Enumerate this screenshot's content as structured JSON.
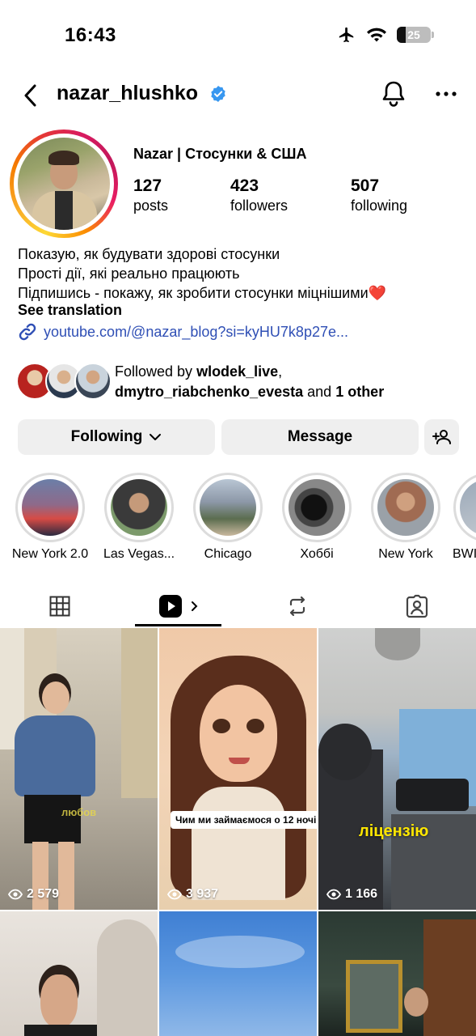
{
  "status_bar": {
    "time": "16:43",
    "battery": "25"
  },
  "header": {
    "username": "nazar_hlushko"
  },
  "profile": {
    "display_name": "Nazar | Стосунки & США",
    "stats": [
      {
        "value": "127",
        "label": "posts"
      },
      {
        "value": "423",
        "label": "followers"
      },
      {
        "value": "507",
        "label": "following"
      }
    ],
    "bio": [
      "Показую, як будувати здорові стосунки",
      "Прості дії, які реально працюють",
      "Підпишись - покажу, як зробити стосунки міцнішими"
    ],
    "bio_emoji": "❤️",
    "see_translation": "See translation",
    "link": "youtube.com/@nazar_blog?si=kyHU7k8p27e...",
    "followed_by": {
      "prefix": "Followed by",
      "user1": "wlodek_live",
      "user2": "dmytro_riabchenko_evesta",
      "and": "and",
      "others": "1 other"
    }
  },
  "actions": {
    "following": "Following",
    "message": "Message"
  },
  "highlights": [
    {
      "label": "New York 2.0"
    },
    {
      "label": "Las  Vegas..."
    },
    {
      "label": "Chicago"
    },
    {
      "label": "Хоббі"
    },
    {
      "label": "New York"
    },
    {
      "label": "BWI"
    }
  ],
  "grid": [
    {
      "views": "2 579",
      "caption": "любов"
    },
    {
      "views": "3 937",
      "caption": "Чим ми займаємося о 12 ночі"
    },
    {
      "views": "1 166",
      "caption": "ліцензію"
    }
  ],
  "colors": {
    "link": "#2f4fb5",
    "verified": "#3897f0",
    "caption_yellow": "#ffe700"
  }
}
